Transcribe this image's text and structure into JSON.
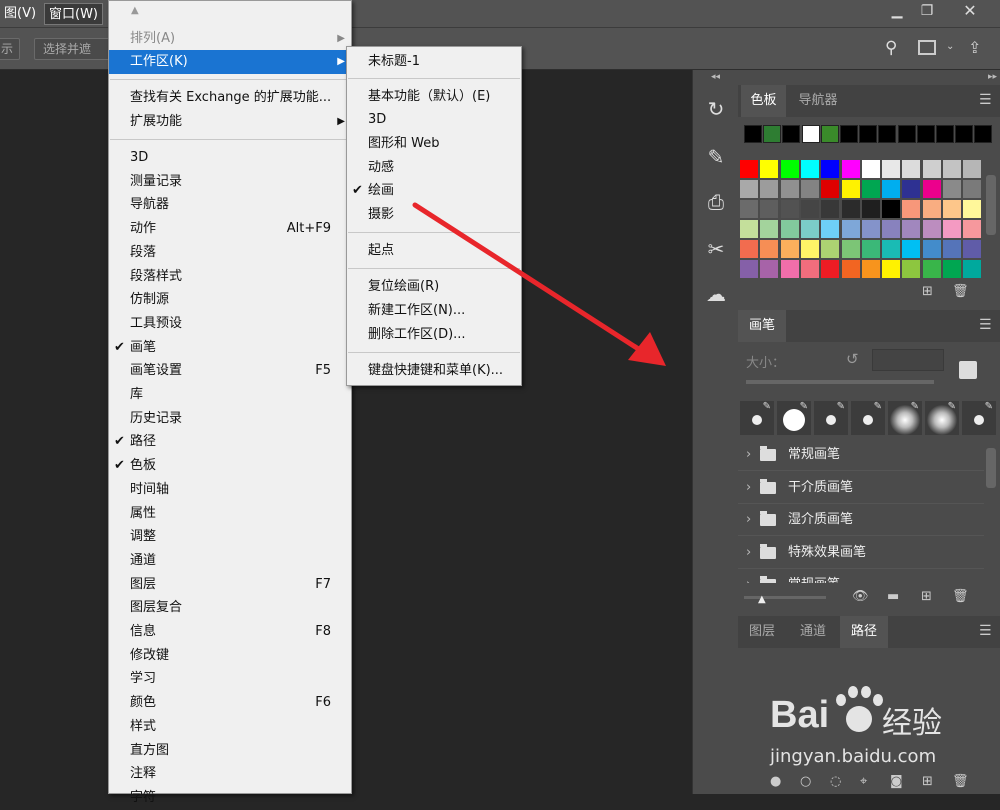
{
  "menubar": {
    "view_fragment": "图(V)",
    "window": "窗口(W)"
  },
  "optionsbar": {
    "left_fragment": "示",
    "select_mask": "选择并遮住..."
  },
  "window_menu": {
    "up_arrow": "▲",
    "arrange": "排列(A)",
    "workspace": "工作区(K)",
    "exchange": "查找有关 Exchange 的扩展功能...",
    "extensions": "扩展功能",
    "items": [
      "3D",
      "测量记录",
      "导航器",
      "动作",
      "段落",
      "段落样式",
      "仿制源",
      "工具预设",
      "画笔",
      "画笔设置",
      "库",
      "历史记录",
      "路径",
      "色板",
      "时间轴",
      "属性",
      "调整",
      "通道",
      "图层",
      "图层复合",
      "信息",
      "修改键",
      "学习",
      "颜色",
      "样式",
      "直方图",
      "注释",
      "字符"
    ],
    "checked": [
      "画笔",
      "路径",
      "色板"
    ],
    "shortcuts": {
      "动作": "Alt+F9",
      "画笔设置": "F5",
      "图层": "F7",
      "信息": "F8",
      "颜色": "F6"
    }
  },
  "workspace_menu": {
    "untitled": "未标题-1",
    "essentials": "基本功能（默认）(E)",
    "threed": "3D",
    "graphics_web": "图形和 Web",
    "motion": "动感",
    "painting": "绘画",
    "photography": "摄影",
    "start": "起点",
    "reset": "复位绘画(R)",
    "new_ws": "新建工作区(N)...",
    "delete_ws": "删除工作区(D)...",
    "keyboard": "键盘快捷键和菜单(K)...",
    "check_mark": "✔"
  },
  "swatches_panel": {
    "tab_swatches": "色板",
    "tab_navigator": "导航器",
    "recent": [
      "#000000",
      "#2e7d32",
      "#000000",
      "#ffffff",
      "#3a8a2a",
      "#000000",
      "#000000",
      "#000000",
      "#000000",
      "#000000",
      "#000000",
      "#000000",
      "#000000"
    ],
    "grid": [
      [
        "#ff0000",
        "#ffff00",
        "#00ff00",
        "#00ffff",
        "#0000ff",
        "#ff00ff",
        "#ffffff",
        "#e8e8e8",
        "#dcdcdc",
        "#cfcfcf",
        "#c3c3c3",
        "#b6b6b6"
      ],
      [
        "#a9a9a9",
        "#9c9c9c",
        "#909090",
        "#838383",
        "#e00000",
        "#fff200",
        "#00a651",
        "#00aeef",
        "#2e3192",
        "#ec008c",
        "#8a8a8a",
        "#7a7a7a"
      ],
      [
        "#6b6b6b",
        "#5e5e5e",
        "#525252",
        "#454545",
        "#383838",
        "#2b2b2b",
        "#1f1f1f",
        "#000000",
        "#f7977a",
        "#f9ad81",
        "#fdc68a",
        "#fff79a"
      ],
      [
        "#c4df9b",
        "#a3d39c",
        "#82ca9d",
        "#7bcdc8",
        "#6ecff6",
        "#7ea7d8",
        "#8493ca",
        "#8882be",
        "#a187be",
        "#bc8dbf",
        "#f49ac2",
        "#f6989d"
      ],
      [
        "#f26c4f",
        "#f68e55",
        "#fbaf5c",
        "#fff467",
        "#acd372",
        "#7cc576",
        "#3bb878",
        "#1abbb4",
        "#00bff3",
        "#438ccb",
        "#5574b9",
        "#605ca8"
      ],
      [
        "#8560a8",
        "#a763a8",
        "#f06eaa",
        "#f26d7d",
        "#ed1c24",
        "#f26522",
        "#f7941d",
        "#fff200",
        "#8dc63f",
        "#39b54a",
        "#00a651",
        "#00a99d"
      ]
    ]
  },
  "brush_panel": {
    "tab": "画笔",
    "size_label": "大小：",
    "folders": [
      "常规画笔",
      "干介质画笔",
      "湿介质画笔",
      "特殊效果画笔",
      "常规画笔"
    ]
  },
  "paths_panel": {
    "tab_layers": "图层",
    "tab_channels": "通道",
    "tab_paths": "路径"
  },
  "watermark": {
    "brand": "Bai",
    "brand2": "经验",
    "url": "jingyan.baidu.com"
  },
  "colors": {
    "highlight": "#1a74d2",
    "arrow": "#e8262b"
  }
}
